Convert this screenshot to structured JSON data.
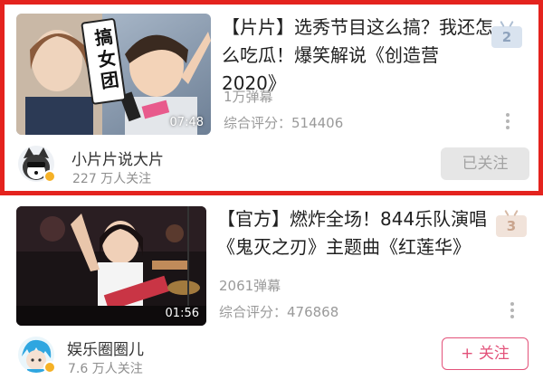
{
  "videos": [
    {
      "title": "【片片】选秀节目这么搞？我还怎么吃瓜！爆笑解说《创造营2020》",
      "thumbnail_caption": "搞女团",
      "duration": "07:48",
      "rank": "2",
      "danmu": "1万弹幕",
      "score": "综合评分：514406",
      "uploader": {
        "name": "小片片说大片",
        "followers": "227 万人关注"
      },
      "follow_label": "已关注",
      "highlighted": true
    },
    {
      "title": "【官方】燃炸全场！844乐队演唱《鬼灭之刃》主题曲《红莲华》",
      "duration": "01:56",
      "rank": "3",
      "danmu": "2061弹幕",
      "score": "综合评分：476868",
      "uploader": {
        "name": "娱乐圈圈儿",
        "followers": "7.6 万人关注"
      },
      "follow_label": "+ 关注",
      "highlighted": false
    }
  ],
  "colors": {
    "highlight_border": "#e4231e",
    "follow_accent": "#e3527a",
    "rank2": "#d9e3ef",
    "rank3": "#f1e3da"
  }
}
